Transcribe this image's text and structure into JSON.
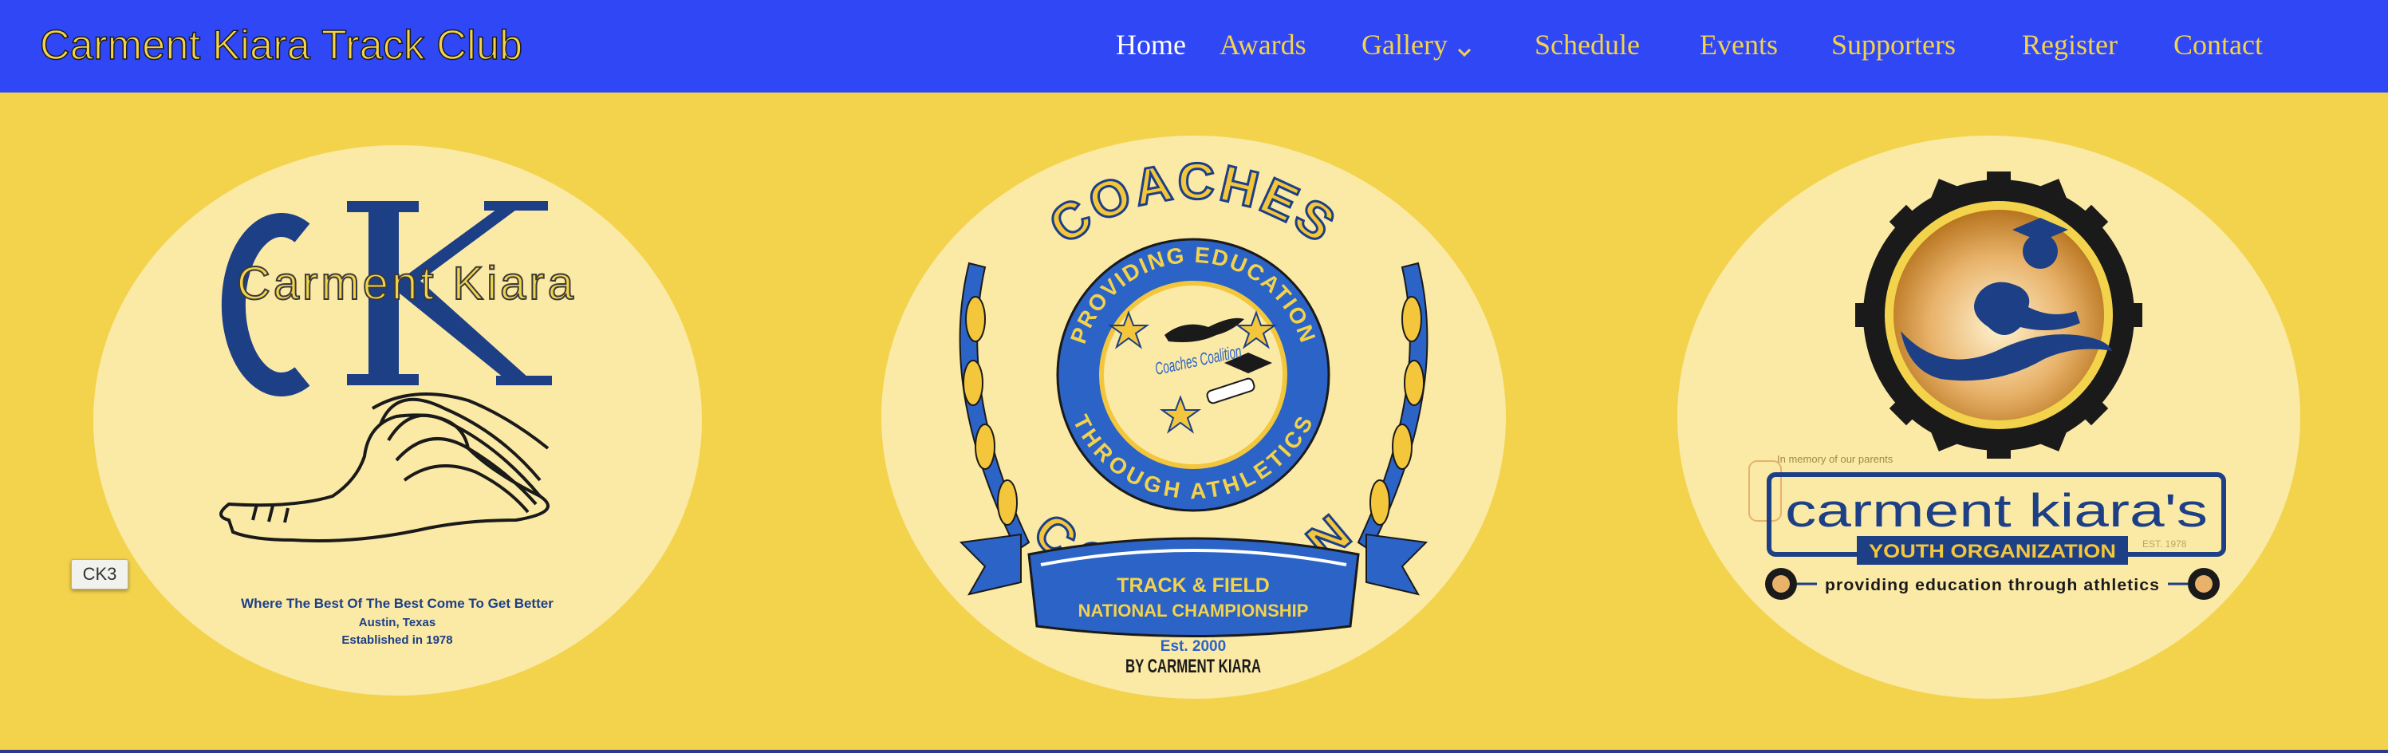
{
  "site": {
    "title": "Carment Kiara Track Club"
  },
  "nav": {
    "items": [
      {
        "label": "Home"
      },
      {
        "label": "Awards"
      },
      {
        "label": "Gallery"
      },
      {
        "label": "Schedule"
      },
      {
        "label": "Events"
      },
      {
        "label": "Supporters"
      },
      {
        "label": "Register"
      },
      {
        "label": "Contact"
      }
    ]
  },
  "logos": {
    "ck": {
      "initials": "CK",
      "name": "Carment Kiara",
      "tagline": "Where The Best Of The Best Come To Get Better",
      "location": "Austin, Texas",
      "established": "Established in 1978"
    },
    "coalition": {
      "top": "COACHES",
      "bottom": "COALITION",
      "ring_top": "PROVIDING EDUCATION",
      "ring_bottom": "THROUGH ATHLETICS",
      "center_script": "Coaches Coalition",
      "banner_line1": "TRACK & FIELD",
      "banner_line2": "NATIONAL CHAMPIONSHIP",
      "est": "Est. 2000",
      "by": "BY CARMENT KIARA"
    },
    "youth": {
      "memory": "In memory of our parents",
      "name": "carment kiara's",
      "banner": "YOUTH ORGANIZATION",
      "est": "EST. 1978",
      "tagline": "providing education through athletics"
    }
  },
  "tooltip": {
    "text": "CK3"
  },
  "colors": {
    "header": "#2f47f5",
    "page": "#f3d34c",
    "navy": "#1c3f86",
    "gold": "#f3d34c"
  }
}
